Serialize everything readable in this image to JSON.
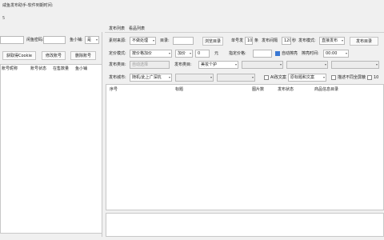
{
  "window": {
    "title": "咸鱼发布助手-软件到期时间:"
  },
  "left": {
    "goofish_password_label": "闲鱼密码:",
    "fish_shop_label": "鱼小铺:",
    "fish_shop_value": "是",
    "buttons": {
      "get_cookie": "获取得Cookie",
      "edit_account": "修改账号",
      "delete_account": "删除账号"
    },
    "columns": [
      "账号昵称",
      "账号状态",
      "在售数量",
      "鱼小铺"
    ]
  },
  "tabs": [
    "发布列表",
    "看品列表"
  ],
  "form": {
    "material_source_label": "素材来源:",
    "material_source_value": "不做处理",
    "directory_label": "目录:",
    "browse_button": "浏览目录",
    "per_account_label": "单号发",
    "per_account_value": "10",
    "per_account_unit": "条",
    "publish_interval_label": "发布间隔",
    "publish_interval_value": "120",
    "seconds_unit": "秒",
    "publish_mode_label": "发布模式:",
    "publish_mode_value": "直接发布",
    "publish_button": "发布目录",
    "pricing_mode_label": "定价模式:",
    "pricing_mode_value": "按价格加价",
    "add_price_value": "加价",
    "add_price_amount": "0",
    "yuan_unit": "元",
    "fixed_price_label": "指定价格:",
    "auto_shelf_label": "自动擦亮",
    "shelf_time_label": "擦亮时间:",
    "shelf_time_value": "00:00",
    "publish_category_label": "发布类目:",
    "category_placeholder": "自动选择",
    "publish_category2_label": "发布类目:",
    "category2_value": "美妆个护",
    "publish_city_label": "发布城市:",
    "city_value": "随机/此上广深杭",
    "ai_copy_label": "AI改文案",
    "title_copy_value": "原标题和文案",
    "desc_no_block_label": "描述不同全屏蔽",
    "item_count_partial": "10"
  },
  "table": {
    "columns": [
      "序号",
      "标题",
      "图片数",
      "发布状态",
      "商品信息目录"
    ]
  }
}
